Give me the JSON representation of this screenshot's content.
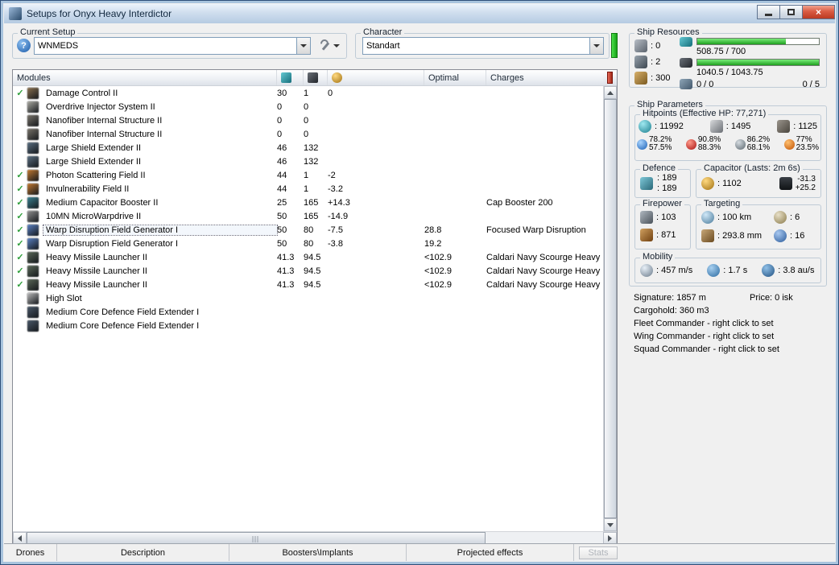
{
  "window": {
    "title": "Setups for Onyx Heavy Interdictor"
  },
  "setup": {
    "group_label": "Current Setup",
    "value": "WNMEDS"
  },
  "character": {
    "group_label": "Character",
    "value": "Standart"
  },
  "modules_table": {
    "header": {
      "modules": "Modules",
      "optimal": "Optimal",
      "charges": "Charges"
    },
    "rows": [
      {
        "checked": true,
        "selected": false,
        "name": "Damage Control II",
        "cpu": "30",
        "pg": "1",
        "cap": "0",
        "optimal": "",
        "charge": "",
        "icon_color": "#8a7150"
      },
      {
        "checked": false,
        "selected": false,
        "name": "Overdrive Injector System II",
        "cpu": "0",
        "pg": "0",
        "cap": "",
        "optimal": "",
        "charge": "",
        "icon_color": "#a8a8a0"
      },
      {
        "checked": false,
        "selected": false,
        "name": "Nanofiber Internal Structure II",
        "cpu": "0",
        "pg": "0",
        "cap": "",
        "optimal": "",
        "charge": "",
        "icon_color": "#78736a"
      },
      {
        "checked": false,
        "selected": false,
        "name": "Nanofiber Internal Structure II",
        "cpu": "0",
        "pg": "0",
        "cap": "",
        "optimal": "",
        "charge": "",
        "icon_color": "#78736a"
      },
      {
        "checked": false,
        "selected": false,
        "name": "Large Shield Extender II",
        "cpu": "46",
        "pg": "132",
        "cap": "",
        "optimal": "",
        "charge": "",
        "icon_color": "#5a6e80"
      },
      {
        "checked": false,
        "selected": false,
        "name": "Large Shield Extender II",
        "cpu": "46",
        "pg": "132",
        "cap": "",
        "optimal": "",
        "charge": "",
        "icon_color": "#5a6e80"
      },
      {
        "checked": true,
        "selected": false,
        "name": "Photon Scattering Field II",
        "cpu": "44",
        "pg": "1",
        "cap": "-2",
        "optimal": "",
        "charge": "",
        "icon_color": "#c07830"
      },
      {
        "checked": true,
        "selected": false,
        "name": "Invulnerability Field II",
        "cpu": "44",
        "pg": "1",
        "cap": "-3.2",
        "optimal": "",
        "charge": "",
        "icon_color": "#c07830"
      },
      {
        "checked": true,
        "selected": false,
        "name": "Medium Capacitor Booster II",
        "cpu": "25",
        "pg": "165",
        "cap": "+14.3",
        "optimal": "",
        "charge": "Cap Booster 200",
        "icon_color": "#3a8090"
      },
      {
        "checked": true,
        "selected": false,
        "name": "10MN MicroWarpdrive II",
        "cpu": "50",
        "pg": "165",
        "cap": "-14.9",
        "optimal": "",
        "charge": "",
        "icon_color": "#909090"
      },
      {
        "checked": true,
        "selected": true,
        "name": "Warp Disruption Field Generator I",
        "cpu": "50",
        "pg": "80",
        "cap": "-7.5",
        "optimal": "28.8",
        "charge": "Focused Warp Disruption",
        "icon_color": "#5a80c0"
      },
      {
        "checked": true,
        "selected": false,
        "name": "Warp Disruption Field Generator I",
        "cpu": "50",
        "pg": "80",
        "cap": "-3.8",
        "optimal": "19.2",
        "charge": "",
        "icon_color": "#5a80c0"
      },
      {
        "checked": true,
        "selected": false,
        "name": "Heavy Missile Launcher II",
        "cpu": "41.3",
        "pg": "94.5",
        "cap": "",
        "optimal": "<102.9",
        "charge": "Caldari Navy Scourge Heavy Missile",
        "icon_color": "#5a6858"
      },
      {
        "checked": true,
        "selected": false,
        "name": "Heavy Missile Launcher II",
        "cpu": "41.3",
        "pg": "94.5",
        "cap": "",
        "optimal": "<102.9",
        "charge": "Caldari Navy Scourge Heavy Missile",
        "icon_color": "#5a6858"
      },
      {
        "checked": true,
        "selected": false,
        "name": "Heavy Missile Launcher II",
        "cpu": "41.3",
        "pg": "94.5",
        "cap": "",
        "optimal": "<102.9",
        "charge": "Caldari Navy Scourge Heavy Missile",
        "icon_color": "#5a6858"
      },
      {
        "checked": false,
        "selected": false,
        "name": "High Slot",
        "cpu": "",
        "pg": "",
        "cap": "",
        "optimal": "",
        "charge": "",
        "icon_color": "#b8b8b8"
      },
      {
        "checked": false,
        "selected": false,
        "name": "Medium Core Defence Field Extender I",
        "cpu": "",
        "pg": "",
        "cap": "",
        "optimal": "",
        "charge": "",
        "icon_color": "#4a5868"
      },
      {
        "checked": false,
        "selected": false,
        "name": "Medium Core Defence Field Extender I",
        "cpu": "",
        "pg": "",
        "cap": "",
        "optimal": "",
        "charge": "",
        "icon_color": "#4a5868"
      }
    ]
  },
  "ship_resources": {
    "group_label": "Ship Resources",
    "turrets": ": 0",
    "launchers": ": 2",
    "calibration": ": 300",
    "cpu": {
      "text": "508.75 / 700",
      "pct": 72.7
    },
    "powergrid": {
      "text": "1040.5 / 1043.75",
      "pct": 99.7
    },
    "dronebay": "0 / 0",
    "drones": "0 / 5"
  },
  "ship_parameters": {
    "group_label": "Ship Parameters",
    "hitpoints": {
      "label": "Hitpoints (Effective HP: 77,271)",
      "shield": ": 11992",
      "armor": ": 1495",
      "hull": ": 1125",
      "resists": {
        "em": {
          "shield": "78.2%",
          "armor": "57.5%"
        },
        "thermal": {
          "shield": "90.8%",
          "armor": "88.3%"
        },
        "kinetic": {
          "shield": "86.2%",
          "armor": "68.1%"
        },
        "explosive": {
          "shield": "77%",
          "armor": "23.5%"
        }
      }
    },
    "defence": {
      "label": "Defence",
      "top": ": 189",
      "bottom": ": 189"
    },
    "capacitor": {
      "label": "Capacitor (Lasts: 2m 6s)",
      "amount": ": 1102",
      "drain": "-31.3",
      "recharge": "+25.2"
    },
    "firepower": {
      "label": "Firepower",
      "volley": ": 103",
      "dps": ": 871"
    },
    "targeting": {
      "label": "Targeting",
      "range": ": 100 km",
      "max_targets": ": 6",
      "scan_res": ": 293.8 mm",
      "sensor_strength": ": 16"
    },
    "mobility": {
      "label": "Mobility",
      "speed": ": 457 m/s",
      "align": ": 1.7 s",
      "warp": ": 3.8 au/s"
    }
  },
  "info": {
    "signature": "Signature: 1857 m",
    "price": "Price: 0 isk",
    "cargohold": "Cargohold: 360 m3",
    "fleet": "Fleet Commander - right click to set",
    "wing": "Wing Commander - right click to set",
    "squad": "Squad Commander - right click to set"
  },
  "bottom_tabs": [
    {
      "label": "Drones"
    },
    {
      "label": "Description"
    },
    {
      "label": "Boosters\\Implants"
    },
    {
      "label": "Projected effects"
    }
  ],
  "stats_button": "Stats",
  "colors": {
    "fit_ok_bar": "#2ecc2e",
    "header_indicator": "#c0301c",
    "check_green": "#2e9e3a"
  }
}
